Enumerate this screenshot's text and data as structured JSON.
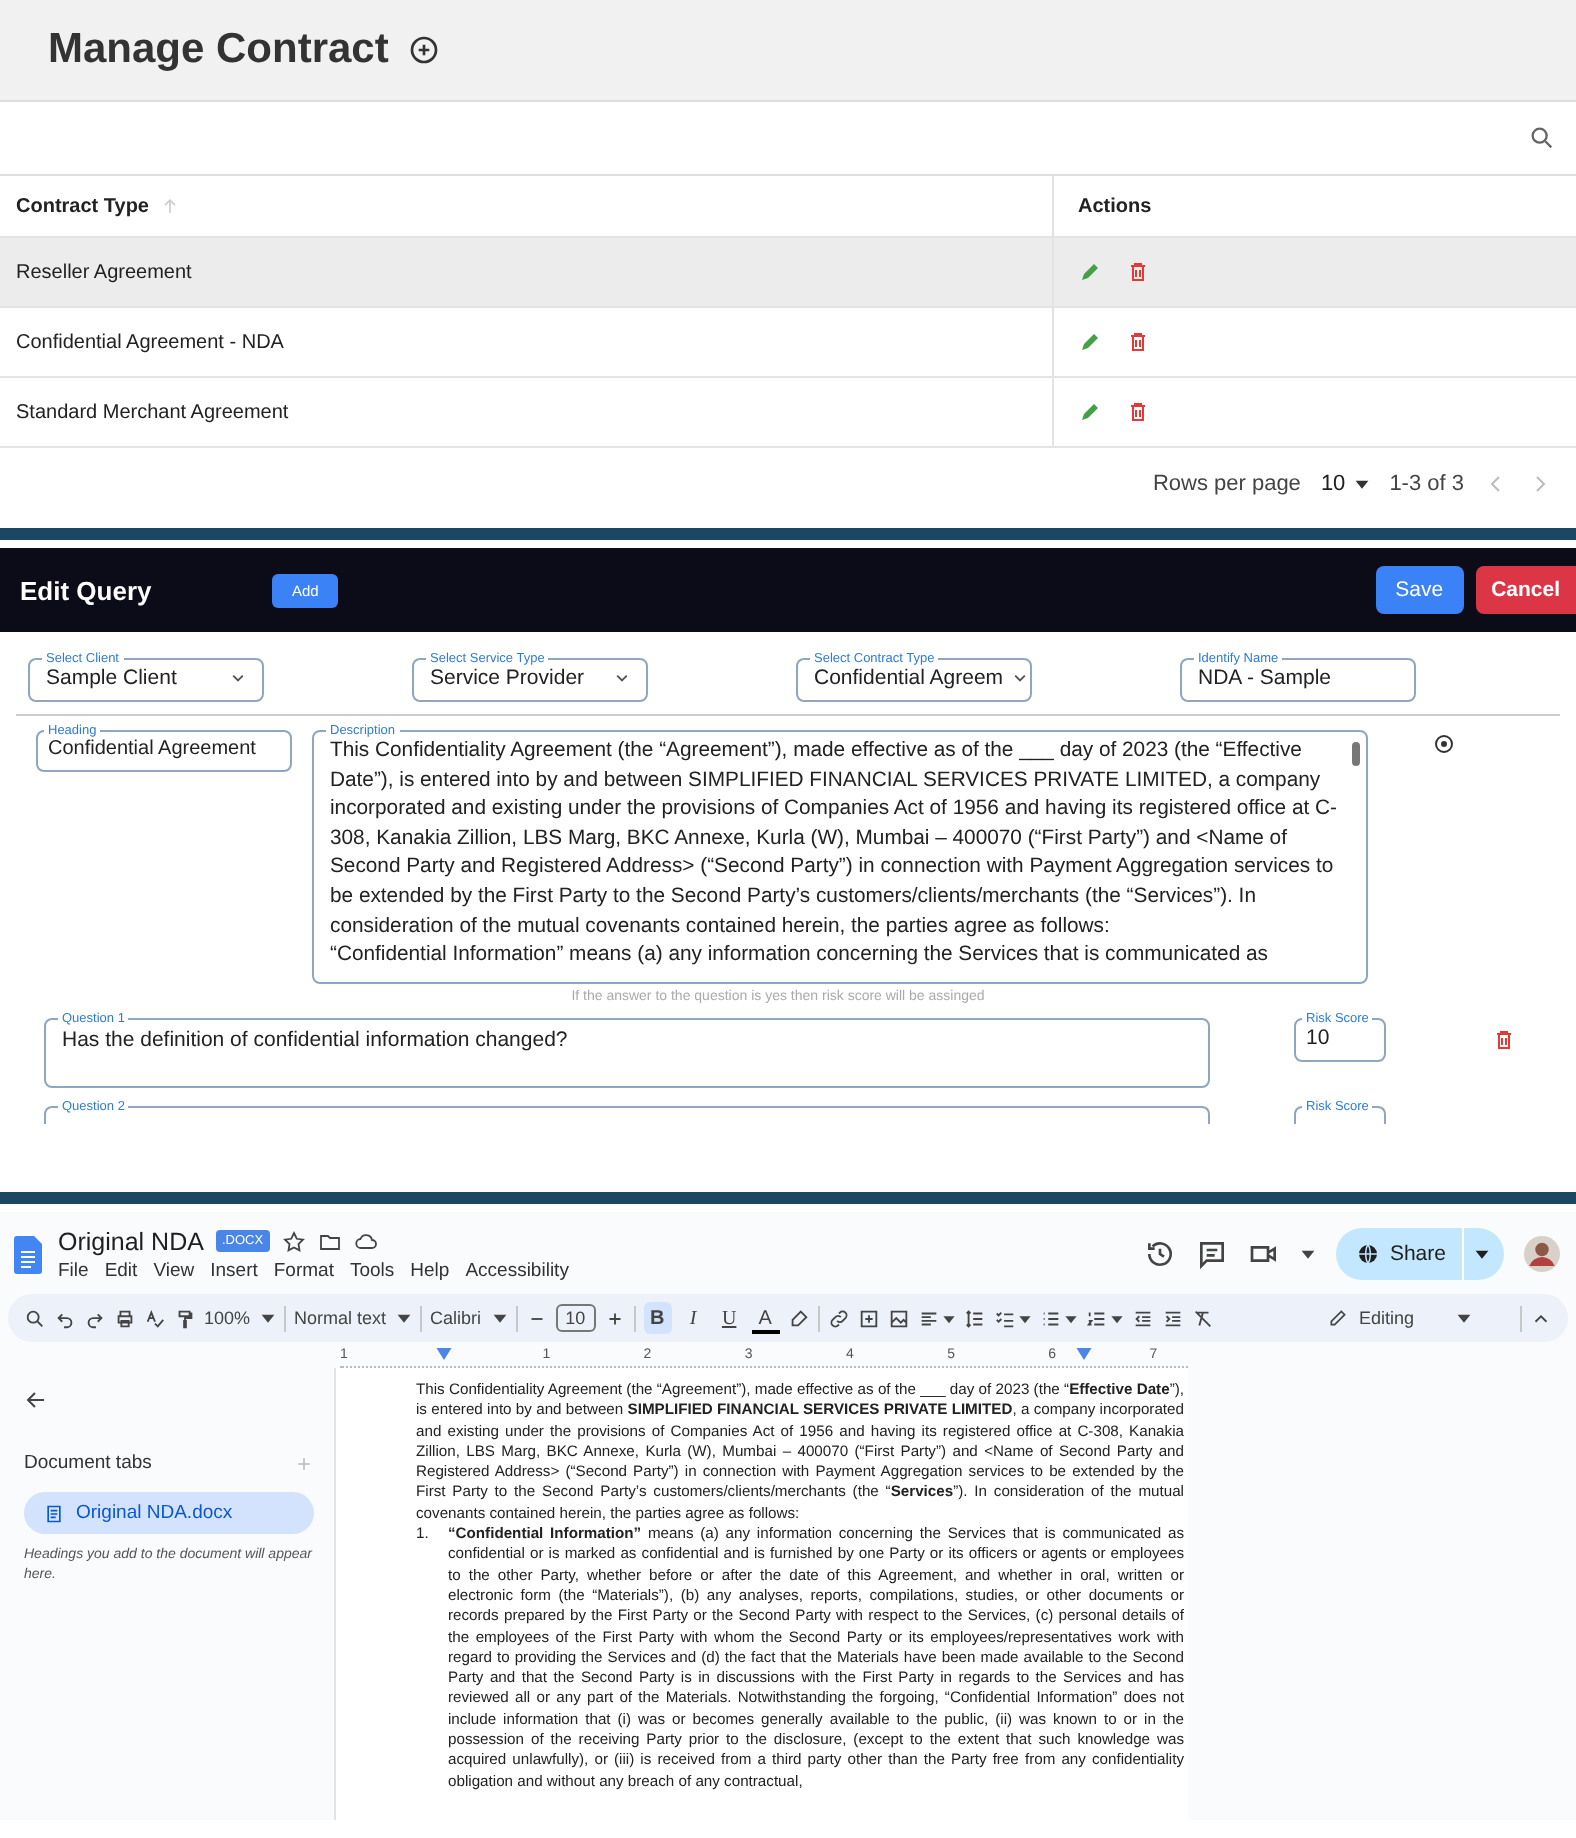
{
  "contracts": {
    "title": "Manage Contract",
    "columns": [
      "Contract Type",
      "Actions"
    ],
    "rows": [
      {
        "name": "Reseller Agreement",
        "highlighted": true
      },
      {
        "name": "Confidential Agreement - NDA",
        "highlighted": false
      },
      {
        "name": "Standard Merchant Agreement",
        "highlighted": false
      }
    ],
    "footer": {
      "rows_per_page_label": "Rows per page",
      "rows_per_page": "10",
      "range": "1-3 of 3"
    }
  },
  "edit_query": {
    "title": "Edit Query",
    "add_button": "Add",
    "save_button": "Save",
    "cancel_button": "Cancel",
    "fields": [
      {
        "label": "Select Client",
        "value": "Sample Client",
        "kind": "select"
      },
      {
        "label": "Select Service Type",
        "value": "Service Provider",
        "kind": "select"
      },
      {
        "label": "Select Contract Type",
        "value": "Confidential Agreem",
        "kind": "select"
      },
      {
        "label": "Identify Name",
        "value": "NDA - Sample",
        "kind": "input"
      }
    ],
    "heading": {
      "label": "Heading",
      "value": "Confidential Agreement"
    },
    "description": {
      "label": "Description",
      "value": "This Confidentiality Agreement (the “Agreement”), made effective as of the ___ day of 2023 (the “Effective Date”), is entered into by and between SIMPLIFIED FINANCIAL SERVICES PRIVATE LIMITED, a company incorporated and existing under the provisions of Companies Act of 1956 and having its registered office at C-308, Kanakia Zillion, LBS Marg, BKC Annexe, Kurla (W), Mumbai – 400070 (“First Party”) and <Name of Second Party and Registered Address> (“Second Party”) in connection with Payment Aggregation services to be extended by the First Party to the Second Party’s customers/clients/merchants (the “Services”).  In consideration of the mutual covenants contained herein, the parties agree as follows:\n“Confidential Information” means (a) any information concerning the Services that is communicated as"
    },
    "hint": "If the answer to the question is yes then risk score will be assinged",
    "questions": [
      {
        "label": "Question 1",
        "value": "Has the definition of confidential information changed?",
        "risk_label": "Risk Score",
        "risk": "10"
      },
      {
        "label": "Question 2",
        "risk_label": "Risk Score"
      }
    ]
  },
  "docs": {
    "title": "Original NDA",
    "badge": ".DOCX",
    "menu": [
      "File",
      "Edit",
      "View",
      "Insert",
      "Format",
      "Tools",
      "Help",
      "Accessibility"
    ],
    "share": "Share",
    "toolbar": {
      "zoom": "100%",
      "style": "Normal text",
      "font": "Calibri",
      "size": "10",
      "format": [
        {
          "kind": "bold",
          "label": "B",
          "active": true
        },
        {
          "kind": "italic",
          "label": "I",
          "active": false
        },
        {
          "kind": "underline",
          "label": "U",
          "active": false
        },
        {
          "kind": "color",
          "label": "A",
          "active": false
        }
      ],
      "mode": "Editing"
    },
    "ruler": [
      "1",
      "1",
      "2",
      "3",
      "4",
      "5",
      "6",
      "7"
    ],
    "sidebar": {
      "heading": "Document tabs",
      "tabs": [
        {
          "label": "Original NDA.docx",
          "selected": true
        }
      ],
      "hint": "Headings you add to the document will appear here."
    },
    "paragraphs": [
      {
        "kind": "text",
        "text": "This Confidentiality Agreement (the “Agreement”), made effective as of the ___ day of 2023 (the “**Effective Date**”), is entered into by and between **SIMPLIFIED FINANCIAL SERVICES PRIVATE LIMITED**, a company incorporated and existing under the provisions of Companies Act of 1956 and having its registered office at C-308, Kanakia Zillion, LBS Marg, BKC Annexe, Kurla (W), Mumbai – 400070 (“First Party”) and <Name of Second Party and Registered Address> (“Second Party”) in connection with Payment Aggregation services to be extended by the First Party to the Second Party’s customers/clients/merchants (the “**Services**”).  In consideration of the mutual covenants contained herein, the parties agree as follows:"
      },
      {
        "kind": "numbered",
        "number": "1.",
        "text": "**“Confidential Information”** means (a) any information concerning the Services that is communicated as confidential or is marked as confidential and is furnished by one Party or its officers or agents or employees to the other Party, whether before or after the date of this Agreement, and whether in oral, written or electronic form (the “Materials”), (b) any analyses, reports, compilations, studies, or other documents or records prepared by the First Party or the Second Party with respect to the Services, (c) personal details of the employees of the First Party with whom the Second Party or its employees/representatives work with regard to providing the Services and (d) the fact that the Materials have been made available to the Second Party and that the Second Party is in discussions with the First Party in regards to the Services and has reviewed all or any part of the Materials. Notwithstanding the forgoing, “Confidential Information” does not include information that (i) was or becomes generally available to the public, (ii) was known to or in the possession of the receiving Party prior to the disclosure, (except to the extent that such knowledge was acquired unlawfully), or (iii) is received from a third party other than the  Party free from any confidentiality obligation and without any breach of any contractual,"
      }
    ]
  }
}
